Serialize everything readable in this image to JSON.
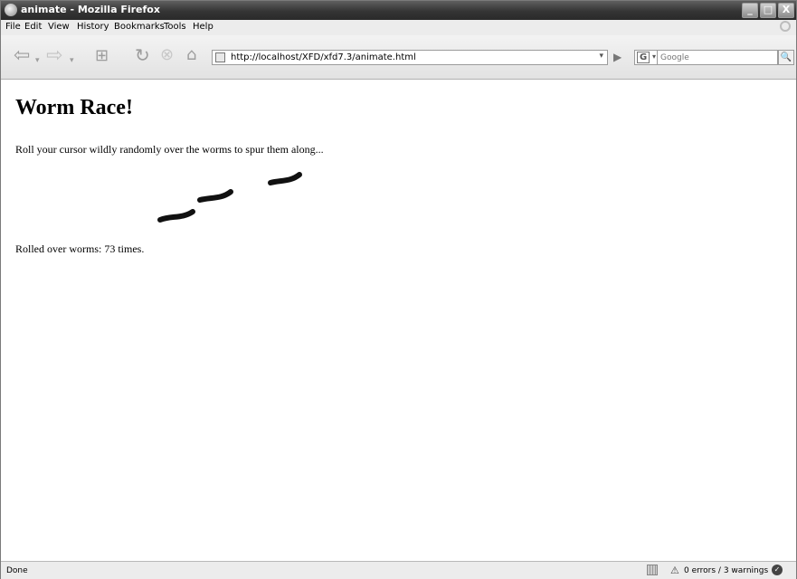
{
  "window": {
    "title": "animate - Mozilla Firefox",
    "controls": {
      "minimize": "_",
      "maximize": "□",
      "close": "X"
    }
  },
  "menu": {
    "items": [
      "File",
      "Edit",
      "View",
      "History",
      "Bookmarks",
      "Tools",
      "Help"
    ]
  },
  "toolbar": {
    "back_icon": "back-arrow-icon",
    "forward_icon": "forward-arrow-icon",
    "new_tab_icon": "new-tab-icon",
    "reload_icon": "reload-icon",
    "stop_icon": "stop-icon",
    "home_icon": "home-icon",
    "url": "http://localhost/XFD/xfd7.3/animate.html",
    "search_placeholder": "Google",
    "search_engine_label": "G"
  },
  "page": {
    "heading": "Worm Race!",
    "instructions": "Roll your cursor wildly randomly over the worms to spur them along...",
    "counter": "Rolled over worms: 73 times.",
    "worm_color": "#111111"
  },
  "statusbar": {
    "status": "Done",
    "errors": "0 errors / 3 warnings"
  }
}
